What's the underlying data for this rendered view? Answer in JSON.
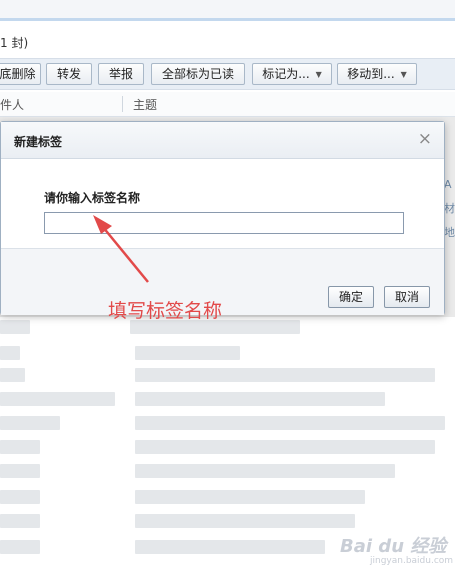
{
  "mail": {
    "count_text": "1 封)",
    "toolbar": {
      "buttons": [
        "彻底删除",
        "转发",
        "举报",
        "全部标为已读",
        "标记为...",
        "移动到..."
      ],
      "visible_labels": [
        "底删除",
        "转发",
        "举报",
        "全部标为已读",
        "标记为...",
        "移动到..."
      ]
    },
    "columns": {
      "sender": "件人",
      "subject": "主题"
    },
    "ghost_right": [
      "A",
      "材",
      "地"
    ]
  },
  "dialog": {
    "title": "新建标签",
    "close": "×",
    "label": "请你输入标签名称",
    "input_value": "",
    "ok": "确定",
    "cancel": "取消"
  },
  "annotation": {
    "text": "填写标签名称",
    "color": "#e24a4a"
  },
  "watermark": {
    "brand": "Bai du 经验",
    "url": "jingyan.baidu.com"
  },
  "colors": {
    "toolbar_bg": "#e8eef5",
    "border": "#a9b8c8",
    "accent": "#c3d8ee"
  }
}
